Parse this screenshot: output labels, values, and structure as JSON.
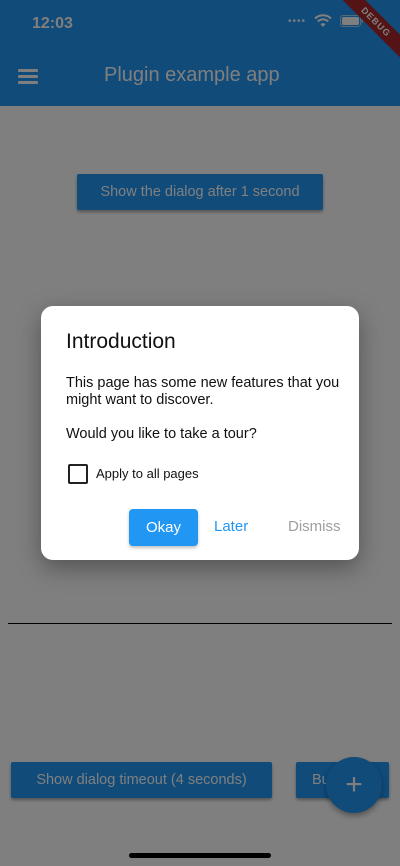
{
  "status_bar": {
    "time": "12:03",
    "debug_label": "DEBUG"
  },
  "app_bar": {
    "title": "Plugin example app"
  },
  "main": {
    "show_dialog_button": "Show the dialog after 1 second",
    "timeout_button": "Show dialog timeout (4 seconds)",
    "partial_button": "Bu"
  },
  "dialog": {
    "title": "Introduction",
    "body": "This page has some new features that you might want to discover.",
    "question": "Would you like to take a tour?",
    "checkbox_label": "Apply to all pages",
    "checkbox_checked": false,
    "actions": {
      "okay": "Okay",
      "later": "Later",
      "dismiss": "Dismiss"
    }
  },
  "fab": {
    "symbol": "+"
  },
  "colors": {
    "primary": "#2196f3",
    "debug_ribbon": "#a9282a",
    "dismiss": "#9e9e9e"
  }
}
